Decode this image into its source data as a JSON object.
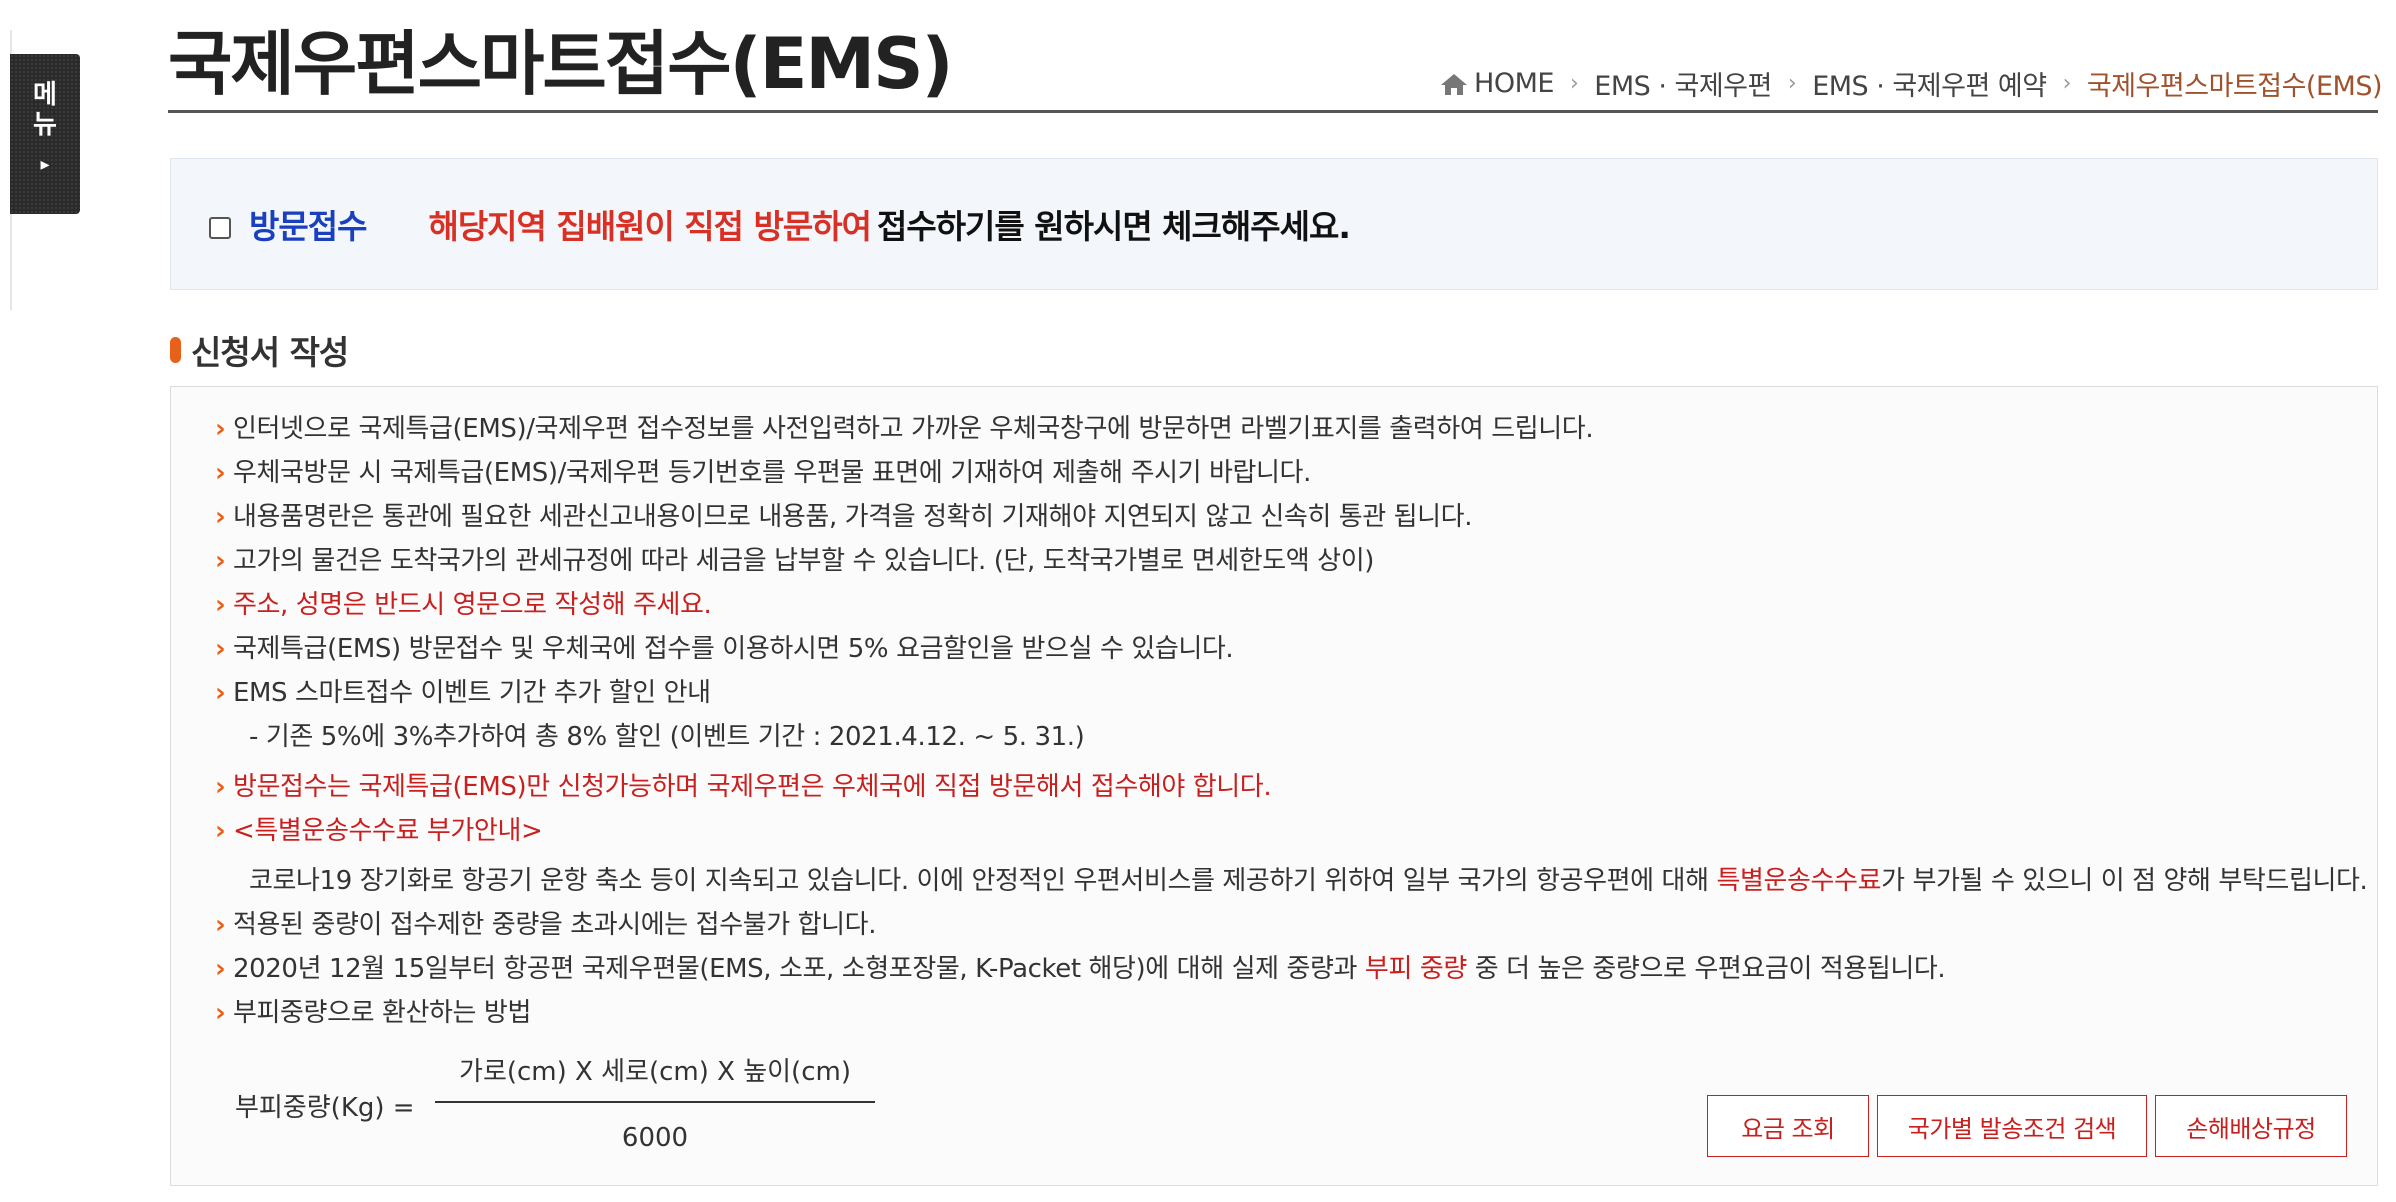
{
  "side_menu": {
    "label": "메뉴",
    "arrow": "▸"
  },
  "header": {
    "title": "국제우편스마트접수(EMS)",
    "breadcrumb": [
      "HOME",
      "EMS · 국제우편",
      "EMS · 국제우편 예약",
      "국제우편스마트접수(EMS)"
    ]
  },
  "visit": {
    "checked": false,
    "label": "방문접수",
    "text_red": "해당지역 집배원이 직접 방문하여",
    "text_dark": "접수하기를 원하시면 체크해주세요."
  },
  "section": {
    "title": "신청서 작성"
  },
  "notices": {
    "n1": "인터넷으로 국제특급(EMS)/국제우편 접수정보를 사전입력하고 가까운 우체국창구에 방문하면 라벨기표지를 출력하여 드립니다.",
    "n2": "우체국방문 시 국제특급(EMS)/국제우편 등기번호를 우편물 표면에 기재하여 제출해 주시기 바랍니다.",
    "n3": "내용품명란은 통관에 필요한 세관신고내용이므로 내용품, 가격을 정확히 기재해야 지연되지 않고 신속히 통관 됩니다.",
    "n4": "고가의 물건은 도착국가의 관세규정에 따라 세금을 납부할 수 있습니다. (단, 도착국가별로 면세한도액 상이)",
    "n5": "주소, 성명은 반드시 영문으로 작성해 주세요.",
    "n6": "국제특급(EMS) 방문접수 및 우체국에 접수를 이용하시면 5% 요금할인을 받으실 수 있습니다.",
    "n7": "EMS 스마트접수 이벤트 기간 추가 할인 안내",
    "n7_sub": "- 기존 5%에 3%추가하여 총 8% 할인 (이벤트 기간 : 2021.4.12. ~ 5. 31.)",
    "n8": "방문접수는 국제특급(EMS)만 신청가능하며 국제우편은 우체국에 직접 방문해서 접수해야 합니다.",
    "n9": "<특별운송수수료 부가안내>",
    "n9_a": "코로나19 장기화로 항공기 운항 축소 등이 지속되고 있습니다. 이에 안정적인 우편서비스를 제공하기 위하여 일부 국가의 항공우편에 대해 ",
    "n9_hl": "특별운송수수료",
    "n9_b": "가 부가될 수 있으니 이 점 양해 부탁드립니다.",
    "n10": "적용된 중량이 접수제한 중량을 초과시에는 접수불가 합니다.",
    "n11_a": "2020년 12월 15일부터 항공편 국제우편물(EMS, 소포, 소형포장물, K-Packet 해당)에 대해 실제 중량과 ",
    "n11_hl": "부피 중량",
    "n11_b": " 중 더 높은 중량으로 우편요금이 적용됩니다.",
    "n12": "부피중량으로 환산하는 방법"
  },
  "formula": {
    "lhs": "부피중량(Kg) =",
    "numerator": "가로(cm) X 세로(cm) X 높이(cm)",
    "denominator": "6000"
  },
  "buttons": {
    "rate": "요금 조회",
    "country": "국가별 발송조건 검색",
    "damage": "손해배상규정"
  },
  "colors": {
    "accent_red": "#c8201e",
    "visit_blue": "#1a3fbf",
    "breadcrumb_current": "#a0522d",
    "bullet_orange": "#e8611a"
  }
}
